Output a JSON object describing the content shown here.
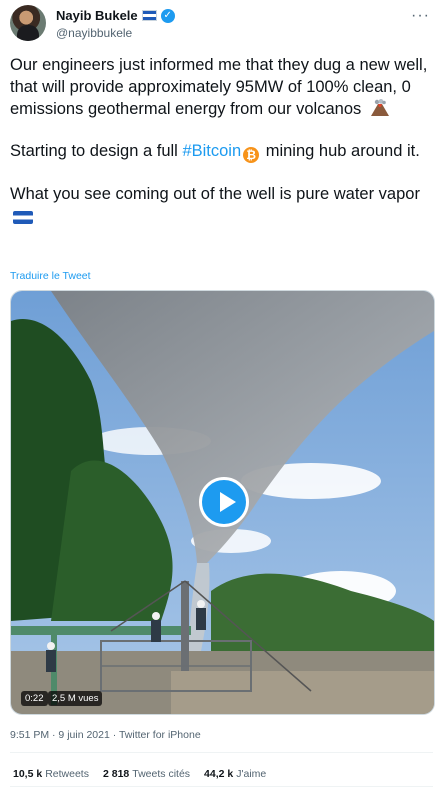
{
  "author": {
    "name": "Nayib Bukele",
    "handle": "@nayibbukele"
  },
  "tweet": {
    "paragraph1": "Our engineers just informed me that they dug a new well, that will provide approximately 95MW of 100% clean, 0 emissions geothermal energy from our volcanos",
    "paragraph2_before": "Starting to design a full ",
    "hashtag": "#Bitcoin",
    "paragraph2_after": "  mining hub around it.",
    "paragraph3": "What you see coming out of the well is pure water vapor",
    "translate_link": "Traduire le Tweet"
  },
  "video": {
    "time": "0:22",
    "views": "2,5 M vues"
  },
  "meta": {
    "timestamp": "9:51 PM · 9 juin 2021 · Twitter for iPhone"
  },
  "stats": {
    "retweets_count": "10,5 k",
    "retweets_label": "Retweets",
    "quotes_count": "2 818",
    "quotes_label": "Tweets cités",
    "likes_count": "44,2 k",
    "likes_label": "J'aime"
  },
  "icons": {
    "verified": "verified-badge-icon",
    "flag": "el-salvador-flag-icon",
    "volcano": "volcano-emoji-icon",
    "bitcoin": "bitcoin-emoji-icon",
    "more": "more-options-icon",
    "play": "play-icon"
  },
  "colors": {
    "accent": "#1d9bf0",
    "text": "#0f1419",
    "secondary": "#536471",
    "bitcoin": "#f7931a"
  }
}
